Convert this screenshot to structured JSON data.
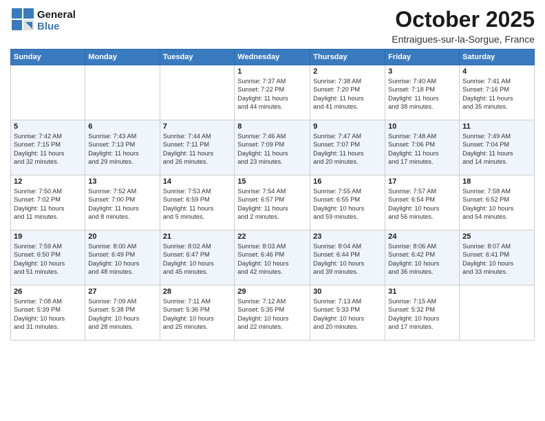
{
  "header": {
    "logo_line1": "General",
    "logo_line2": "Blue",
    "month_title": "October 2025",
    "location": "Entraigues-sur-la-Sorgue, France"
  },
  "days_of_week": [
    "Sunday",
    "Monday",
    "Tuesday",
    "Wednesday",
    "Thursday",
    "Friday",
    "Saturday"
  ],
  "weeks": [
    [
      {
        "num": "",
        "info": ""
      },
      {
        "num": "",
        "info": ""
      },
      {
        "num": "",
        "info": ""
      },
      {
        "num": "1",
        "info": "Sunrise: 7:37 AM\nSunset: 7:22 PM\nDaylight: 11 hours\nand 44 minutes."
      },
      {
        "num": "2",
        "info": "Sunrise: 7:38 AM\nSunset: 7:20 PM\nDaylight: 11 hours\nand 41 minutes."
      },
      {
        "num": "3",
        "info": "Sunrise: 7:40 AM\nSunset: 7:18 PM\nDaylight: 11 hours\nand 38 minutes."
      },
      {
        "num": "4",
        "info": "Sunrise: 7:41 AM\nSunset: 7:16 PM\nDaylight: 11 hours\nand 35 minutes."
      }
    ],
    [
      {
        "num": "5",
        "info": "Sunrise: 7:42 AM\nSunset: 7:15 PM\nDaylight: 11 hours\nand 32 minutes."
      },
      {
        "num": "6",
        "info": "Sunrise: 7:43 AM\nSunset: 7:13 PM\nDaylight: 11 hours\nand 29 minutes."
      },
      {
        "num": "7",
        "info": "Sunrise: 7:44 AM\nSunset: 7:11 PM\nDaylight: 11 hours\nand 26 minutes."
      },
      {
        "num": "8",
        "info": "Sunrise: 7:46 AM\nSunset: 7:09 PM\nDaylight: 11 hours\nand 23 minutes."
      },
      {
        "num": "9",
        "info": "Sunrise: 7:47 AM\nSunset: 7:07 PM\nDaylight: 11 hours\nand 20 minutes."
      },
      {
        "num": "10",
        "info": "Sunrise: 7:48 AM\nSunset: 7:06 PM\nDaylight: 11 hours\nand 17 minutes."
      },
      {
        "num": "11",
        "info": "Sunrise: 7:49 AM\nSunset: 7:04 PM\nDaylight: 11 hours\nand 14 minutes."
      }
    ],
    [
      {
        "num": "12",
        "info": "Sunrise: 7:50 AM\nSunset: 7:02 PM\nDaylight: 11 hours\nand 11 minutes."
      },
      {
        "num": "13",
        "info": "Sunrise: 7:52 AM\nSunset: 7:00 PM\nDaylight: 11 hours\nand 8 minutes."
      },
      {
        "num": "14",
        "info": "Sunrise: 7:53 AM\nSunset: 6:59 PM\nDaylight: 11 hours\nand 5 minutes."
      },
      {
        "num": "15",
        "info": "Sunrise: 7:54 AM\nSunset: 6:57 PM\nDaylight: 11 hours\nand 2 minutes."
      },
      {
        "num": "16",
        "info": "Sunrise: 7:55 AM\nSunset: 6:55 PM\nDaylight: 10 hours\nand 59 minutes."
      },
      {
        "num": "17",
        "info": "Sunrise: 7:57 AM\nSunset: 6:54 PM\nDaylight: 10 hours\nand 56 minutes."
      },
      {
        "num": "18",
        "info": "Sunrise: 7:58 AM\nSunset: 6:52 PM\nDaylight: 10 hours\nand 54 minutes."
      }
    ],
    [
      {
        "num": "19",
        "info": "Sunrise: 7:59 AM\nSunset: 6:50 PM\nDaylight: 10 hours\nand 51 minutes."
      },
      {
        "num": "20",
        "info": "Sunrise: 8:00 AM\nSunset: 6:49 PM\nDaylight: 10 hours\nand 48 minutes."
      },
      {
        "num": "21",
        "info": "Sunrise: 8:02 AM\nSunset: 6:47 PM\nDaylight: 10 hours\nand 45 minutes."
      },
      {
        "num": "22",
        "info": "Sunrise: 8:03 AM\nSunset: 6:46 PM\nDaylight: 10 hours\nand 42 minutes."
      },
      {
        "num": "23",
        "info": "Sunrise: 8:04 AM\nSunset: 6:44 PM\nDaylight: 10 hours\nand 39 minutes."
      },
      {
        "num": "24",
        "info": "Sunrise: 8:06 AM\nSunset: 6:42 PM\nDaylight: 10 hours\nand 36 minutes."
      },
      {
        "num": "25",
        "info": "Sunrise: 8:07 AM\nSunset: 6:41 PM\nDaylight: 10 hours\nand 33 minutes."
      }
    ],
    [
      {
        "num": "26",
        "info": "Sunrise: 7:08 AM\nSunset: 5:39 PM\nDaylight: 10 hours\nand 31 minutes."
      },
      {
        "num": "27",
        "info": "Sunrise: 7:09 AM\nSunset: 5:38 PM\nDaylight: 10 hours\nand 28 minutes."
      },
      {
        "num": "28",
        "info": "Sunrise: 7:11 AM\nSunset: 5:36 PM\nDaylight: 10 hours\nand 25 minutes."
      },
      {
        "num": "29",
        "info": "Sunrise: 7:12 AM\nSunset: 5:35 PM\nDaylight: 10 hours\nand 22 minutes."
      },
      {
        "num": "30",
        "info": "Sunrise: 7:13 AM\nSunset: 5:33 PM\nDaylight: 10 hours\nand 20 minutes."
      },
      {
        "num": "31",
        "info": "Sunrise: 7:15 AM\nSunset: 5:32 PM\nDaylight: 10 hours\nand 17 minutes."
      },
      {
        "num": "",
        "info": ""
      }
    ]
  ]
}
